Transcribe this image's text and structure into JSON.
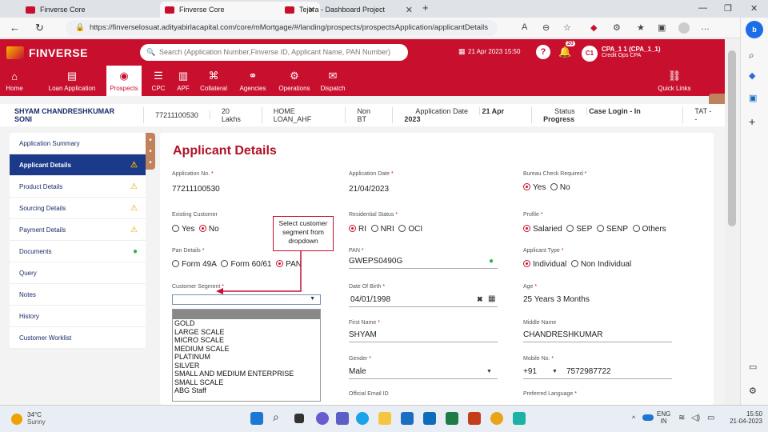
{
  "browser": {
    "tabs": [
      {
        "label": "Finverse Core"
      },
      {
        "label": "Finverse Core"
      },
      {
        "label": "Tejora - Dashboard Project"
      }
    ],
    "url": "https://finverselosuat.adityabirlacapital.com/core/mMortgage/#/landing/prospects/prospectsApplication/applicantDetails"
  },
  "header": {
    "brand": "FINVERSE",
    "search_placeholder": "Search (Application Number,Finverse ID, Applicant Name, PAN Number)",
    "datetime": "21 Apr 2023 15:50",
    "notif_count": "20",
    "user_initials": "C1",
    "user_name": "CPA_1 1 (CPA_1_1)",
    "user_role": "Credit Ops CPA"
  },
  "nav": [
    {
      "label": "Home",
      "icon": "home-icon"
    },
    {
      "label": "Loan Application",
      "icon": "loan-icon"
    },
    {
      "label": "Prospects",
      "icon": "prospects-icon"
    },
    {
      "label": "CPC",
      "icon": "cpc-icon"
    },
    {
      "label": "APF",
      "icon": "apf-icon"
    },
    {
      "label": "Collateral",
      "icon": "collateral-icon"
    },
    {
      "label": "Agencies",
      "icon": "agencies-icon"
    },
    {
      "label": "Operations",
      "icon": "operations-icon"
    },
    {
      "label": "Dispatch",
      "icon": "dispatch-icon"
    }
  ],
  "quick_links": "Quick Links",
  "infobar": {
    "name": "SHYAM CHANDRESHKUMAR SONI",
    "app_no": "77211100530",
    "amount": "20 Lakhs",
    "product": "HOME LOAN_AHF",
    "bt": "Non BT",
    "app_date_label": "Application Date",
    "app_date": "21 Apr 2023",
    "status_label": "Status",
    "status": "Case Login - In Progress",
    "tat": "TAT --"
  },
  "menu": [
    {
      "label": "Application Summary",
      "status": ""
    },
    {
      "label": "Applicant Details",
      "status": "warn"
    },
    {
      "label": "Product Details",
      "status": "warn"
    },
    {
      "label": "Sourcing Details",
      "status": "warn"
    },
    {
      "label": "Payment Details",
      "status": "warn"
    },
    {
      "label": "Documents",
      "status": "ok"
    },
    {
      "label": "Query",
      "status": ""
    },
    {
      "label": "Notes",
      "status": ""
    },
    {
      "label": "History",
      "status": ""
    },
    {
      "label": "Customer Worklist",
      "status": ""
    }
  ],
  "form": {
    "title": "Applicant Details",
    "application_no_label": "Application No.",
    "application_no": "77211100530",
    "application_date_label": "Application Date",
    "application_date": "21/04/2023",
    "bureau_label": "Bureau Check Required",
    "bureau_yes": "Yes",
    "bureau_no": "No",
    "existing_label": "Existing Customer",
    "existing_yes": "Yes",
    "existing_no": "No",
    "residential_label": "Residential Status",
    "res_ri": "RI",
    "res_nri": "NRI",
    "res_oci": "OCI",
    "profile_label": "Profile",
    "prof_salaried": "Salaried",
    "prof_sep": "SEP",
    "prof_senp": "SENP",
    "prof_others": "Others",
    "pan_details_label": "Pan Details",
    "pan_form49a": "Form 49A",
    "pan_form6061": "Form 60/61",
    "pan_pan": "PAN",
    "pan_label": "PAN",
    "pan": "GWEPS0490G",
    "applicant_type_label": "Applicant Type",
    "type_individual": "Individual",
    "type_non_individual": "Non Individual",
    "segment_label": "Customer Segment",
    "dob_label": "Date Of Birth",
    "dob": "04/01/1998",
    "age_label": "Age",
    "age": "25 Years 3 Months",
    "first_name_label": "First Name",
    "first_name": "SHYAM",
    "middle_name_label": "Middle Name",
    "middle_name": "CHANDRESHKUMAR",
    "gender_label": "Gender",
    "gender": "Male",
    "mobile_label": "Mobile No.",
    "mobile_cc": "+91",
    "mobile": "7572987722",
    "email_label": "Official Email ID",
    "language_label": "Preferred Language"
  },
  "segment_options": [
    "GOLD",
    "LARGE SCALE",
    "MICRO SCALE",
    "MEDIUM SCALE",
    "PLATINUM",
    "SILVER",
    "SMALL AND MEDIUM ENTERPRISE",
    "SMALL SCALE",
    "ABG Staff"
  ],
  "callout": "Select customer segment from dropdown",
  "taskbar": {
    "weather_temp": "34°C",
    "weather_desc": "Sunny",
    "lang": "ENG",
    "region": "IN",
    "time": "15:50",
    "date": "21-04-2023"
  },
  "colors": {
    "brand": "#c8102e",
    "menu_selected": "#1b3a8a",
    "warn": "#f0a000",
    "ok": "#2db54a"
  }
}
